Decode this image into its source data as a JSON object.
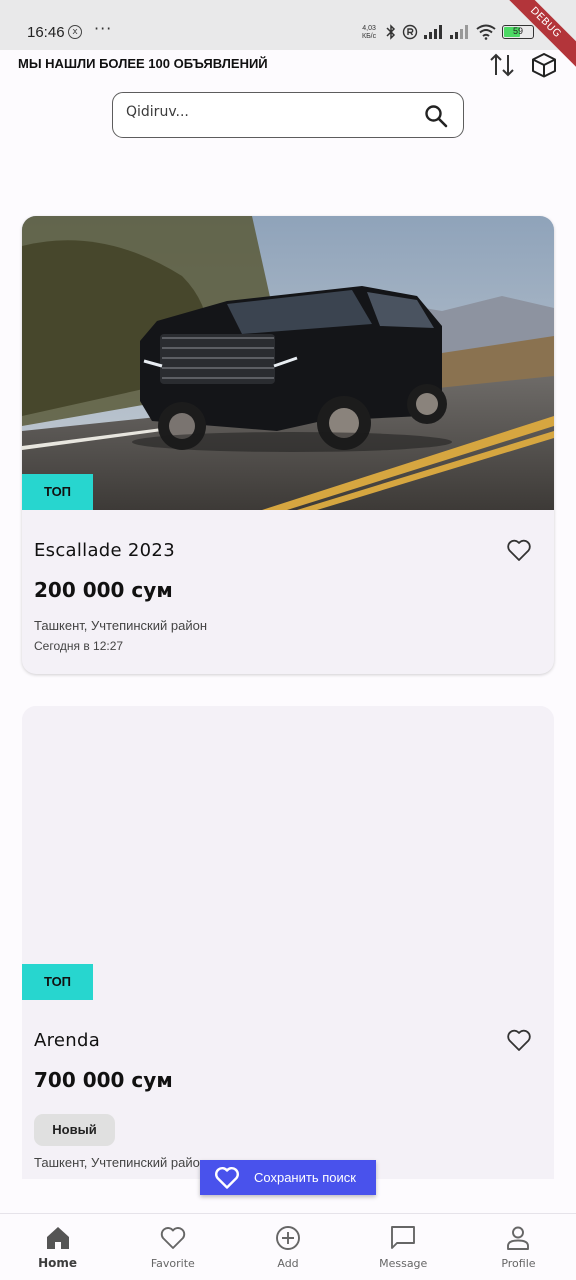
{
  "status_bar": {
    "time": "16:46",
    "x_icon_label": "x",
    "dots": "···",
    "speed_value": "4,03",
    "speed_unit": "КБ/с",
    "battery_percent": 59,
    "battery_label": "59",
    "debug_label": "DEBUG",
    "icons": [
      "close-circle-icon",
      "bluetooth-icon",
      "registered-icon",
      "signal-icon",
      "signal-icon",
      "wifi-icon",
      "battery-icon"
    ]
  },
  "header": {
    "title": "МЫ НАШЛИ БОЛЕЕ 100 ОБЪЯВЛЕНИЙ",
    "sort_icon": "sort-arrows-icon",
    "view_icon": "cube-icon"
  },
  "search": {
    "placeholder": "Qidiruv...",
    "icon": "search-icon"
  },
  "listings": [
    {
      "badge": "ТОП",
      "title": "Escallade 2023",
      "price": "200 000 сум",
      "location": "Ташкент, Учтепинский район",
      "date": "Сегодня в 12:27",
      "has_photo": true
    },
    {
      "badge": "ТОП",
      "title": "Arenda",
      "price": "700 000 сум",
      "condition": "Новый",
      "location": "Ташкент, Учтепинский район",
      "has_photo": false
    }
  ],
  "save_search": {
    "label": "Сохранить поиск",
    "icon": "heart-icon"
  },
  "bottom_nav": {
    "active": "Home",
    "items": [
      {
        "label": "Home",
        "icon": "home-icon"
      },
      {
        "label": "Favorite",
        "icon": "heart-icon"
      },
      {
        "label": "Add",
        "icon": "plus-circle-icon"
      },
      {
        "label": "Message",
        "icon": "chat-icon"
      },
      {
        "label": "Profile",
        "icon": "person-icon"
      }
    ]
  },
  "colors": {
    "accent_badge": "#27d6cf",
    "save_button": "#4952ec",
    "card_background": "#f4f1f7",
    "debug_ribbon": "#b3353a"
  }
}
